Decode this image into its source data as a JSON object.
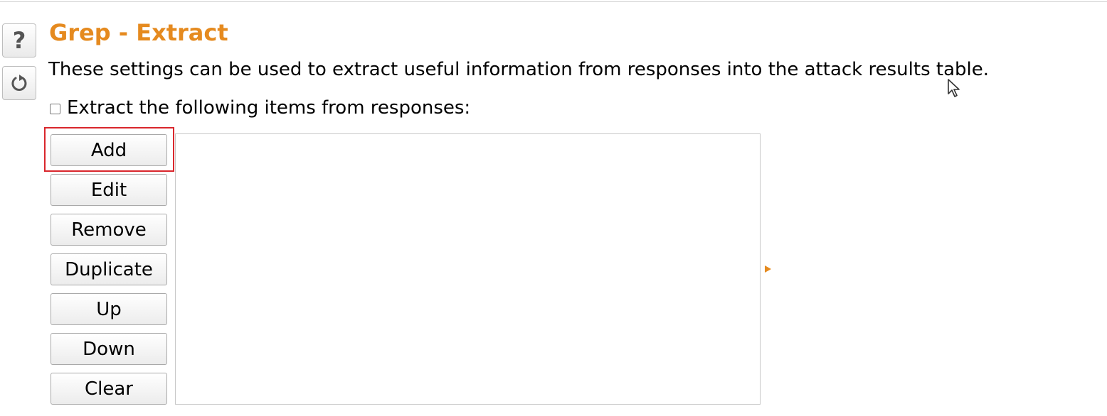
{
  "panel": {
    "title": "Grep - Extract",
    "description": "These settings can be used to extract useful information from responses into the attack results table.",
    "checkbox_label": "Extract the following items from responses:",
    "checkbox_checked": false
  },
  "side_buttons": {
    "help_glyph": "?",
    "help_icon": "help-icon",
    "reset_icon": "reset-icon"
  },
  "buttons": {
    "add": "Add",
    "edit": "Edit",
    "remove": "Remove",
    "duplicate": "Duplicate",
    "up": "Up",
    "down": "Down",
    "clear": "Clear"
  },
  "items": [],
  "colors": {
    "title": "#e58a1f",
    "highlight": "#d9262c",
    "arrow": "#e58a1f"
  }
}
